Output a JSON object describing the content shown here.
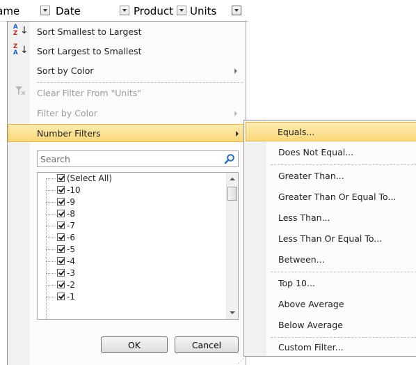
{
  "header": {
    "col_name": "Name",
    "col_date": "Date",
    "col_product": "Product",
    "col_units": "Units"
  },
  "menu": {
    "sort_asc": "Sort Smallest to Largest",
    "sort_desc": "Sort Largest to Smallest",
    "sort_color": "Sort by Color",
    "clear_filter": "Clear Filter From \"Units\"",
    "filter_color": "Filter by Color",
    "number_filters": "Number Filters",
    "search_placeholder": "Search",
    "list_items": [
      "(Select All)",
      "-10",
      "-9",
      "-8",
      "-7",
      "-6",
      "-5",
      "-4",
      "-3",
      "-2",
      "-1"
    ],
    "ok": "OK",
    "cancel": "Cancel"
  },
  "submenu": {
    "items": [
      "Equals...",
      "Does Not Equal...",
      "Greater Than...",
      "Greater Than Or Equal To...",
      "Less Than...",
      "Less Than Or Equal To...",
      "Between...",
      "Top 10...",
      "Above Average",
      "Below Average",
      "Custom Filter..."
    ]
  },
  "colors": {
    "highlight_top": "#fdedb0",
    "highlight_bottom": "#fbd77a",
    "highlight_border": "#e5b64a",
    "disabled_text": "#9a9a9a"
  },
  "icons": [
    "sort-ascending-icon",
    "sort-descending-icon",
    "clear-filter-icon",
    "search-icon",
    "submenu-arrow-icon",
    "checkbox-icon",
    "resize-grip-icon"
  ]
}
